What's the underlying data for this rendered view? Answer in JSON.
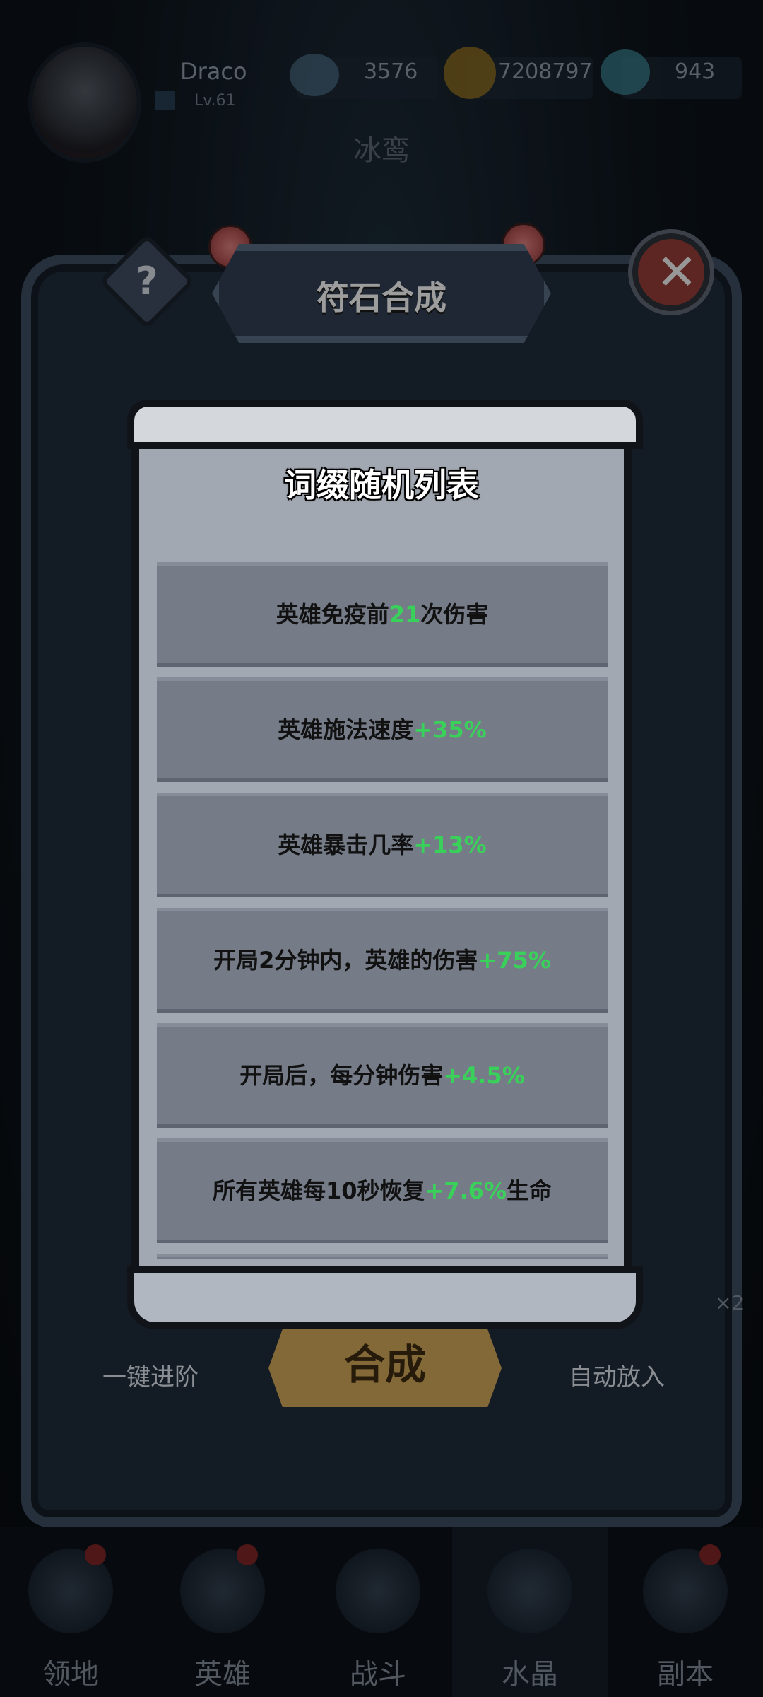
{
  "player": {
    "name": "Draco",
    "level": "Lv.61"
  },
  "resources": {
    "stamina": "3576",
    "gold": "7208797",
    "gems": "943"
  },
  "background_subtitle": "冰鸾",
  "modal": {
    "title": "符石合成",
    "help_icon": "question-icon",
    "close_icon": "close-icon"
  },
  "affix_list": {
    "title": "词缀随机列表",
    "items": [
      {
        "pre": "英雄免疫前",
        "val": "21",
        "post": "次伤害"
      },
      {
        "pre": "英雄施法速度",
        "val": "+35%",
        "post": ""
      },
      {
        "pre": "英雄暴击几率",
        "val": "+13%",
        "post": ""
      },
      {
        "pre": "开局2分钟内，英雄的伤害",
        "val": "+75%",
        "post": ""
      },
      {
        "pre": "开局后，每分钟伤害",
        "val": "+4.5%",
        "post": ""
      },
      {
        "pre": "所有英雄每10秒恢复",
        "val": "+7.6%",
        "post": "生命"
      }
    ]
  },
  "actions": {
    "upgrade_all": "一键进阶",
    "compose": "合成",
    "auto_place": "自动放入",
    "multiplier": "×2"
  },
  "bottom_nav": [
    {
      "label": "领地",
      "icon": "territory-icon"
    },
    {
      "label": "英雄",
      "icon": "hero-icon"
    },
    {
      "label": "战斗",
      "icon": "battle-icon"
    },
    {
      "label": "水晶",
      "icon": "crystal-icon"
    },
    {
      "label": "副本",
      "icon": "dungeon-icon"
    }
  ],
  "colors": {
    "accent_green": "#39d15a",
    "close_red": "#8f3b35"
  }
}
